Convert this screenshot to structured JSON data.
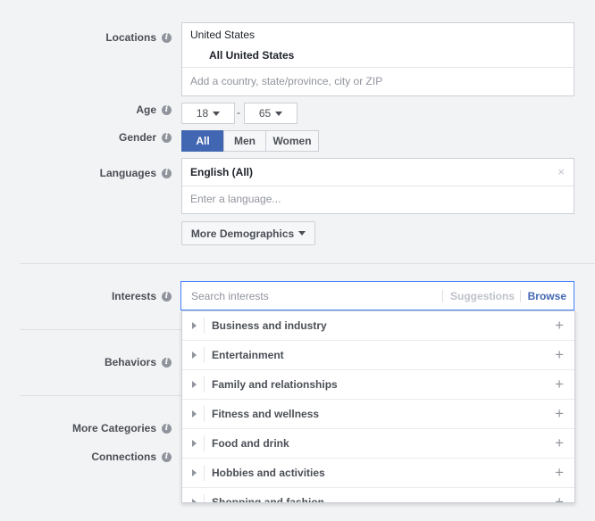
{
  "locations": {
    "label": "Locations",
    "country": "United States",
    "selected": "All United States",
    "placeholder": "Add a country, state/province, city or ZIP"
  },
  "age": {
    "label": "Age",
    "min": "18",
    "max": "65",
    "separator": "-"
  },
  "gender": {
    "label": "Gender",
    "options": [
      "All",
      "Men",
      "Women"
    ],
    "selected": "All"
  },
  "languages": {
    "label": "Languages",
    "selected": "English (All)",
    "remove": "×",
    "placeholder": "Enter a language..."
  },
  "more_demographics": "More Demographics",
  "interests": {
    "label": "Interests",
    "placeholder": "Search interests",
    "suggestions": "Suggestions",
    "browse": "Browse",
    "categories": [
      "Business and industry",
      "Entertainment",
      "Family and relationships",
      "Fitness and wellness",
      "Food and drink",
      "Hobbies and activities",
      "Shopping and fashion"
    ]
  },
  "behaviors": {
    "label": "Behaviors"
  },
  "more_categories": {
    "label": "More Categories"
  },
  "connections": {
    "label": "Connections"
  },
  "info_glyph": "i",
  "plus_glyph": "+",
  "colors": {
    "accent": "#4267b2",
    "focus_border": "#4080ff",
    "background": "#f2f3f5"
  }
}
